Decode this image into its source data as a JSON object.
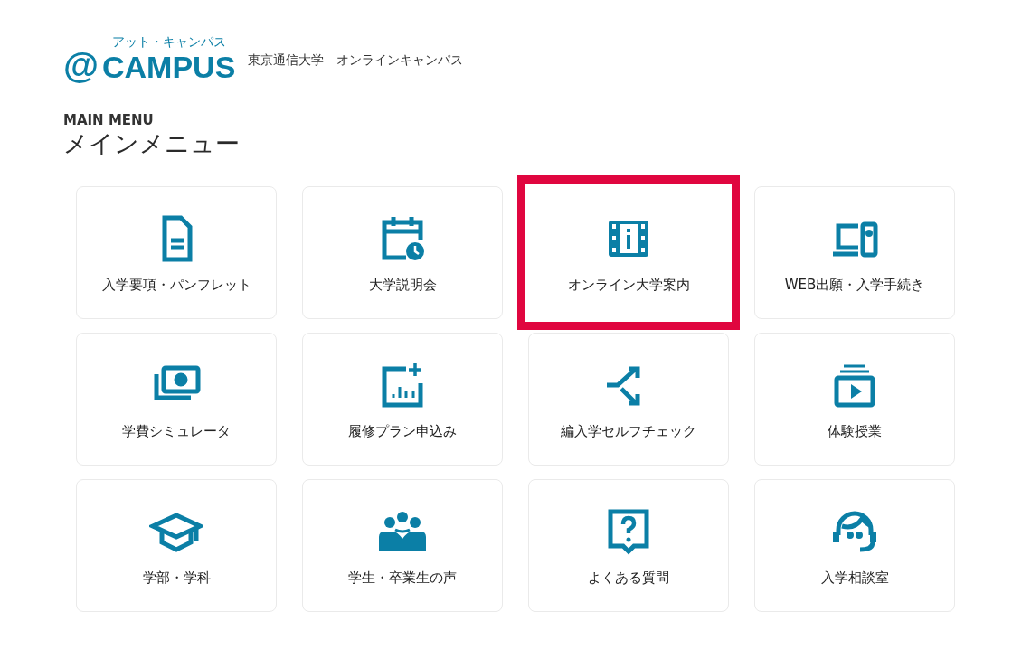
{
  "header": {
    "logo_ruby": "アット・キャンパス",
    "logo_at": "@",
    "logo_text": "CAMPUS",
    "site_name": "東京通信大学　オンラインキャンパス"
  },
  "menu": {
    "subtitle": "MAIN MENU",
    "title": "メインメニュー",
    "items": [
      {
        "label": "入学要項・パンフレット",
        "selected": false
      },
      {
        "label": "大学説明会",
        "selected": false
      },
      {
        "label": "オンライン大学案内",
        "selected": true
      },
      {
        "label": "WEB出願・入学手続き",
        "selected": false
      },
      {
        "label": "学費シミュレータ",
        "selected": false
      },
      {
        "label": "履修プラン申込み",
        "selected": false
      },
      {
        "label": "編入学セルフチェック",
        "selected": false
      },
      {
        "label": "体験授業",
        "selected": false
      },
      {
        "label": "学部・学科",
        "selected": false
      },
      {
        "label": "学生・卒業生の声",
        "selected": false
      },
      {
        "label": "よくある質問",
        "selected": false
      },
      {
        "label": "入学相談室",
        "selected": false
      }
    ]
  }
}
